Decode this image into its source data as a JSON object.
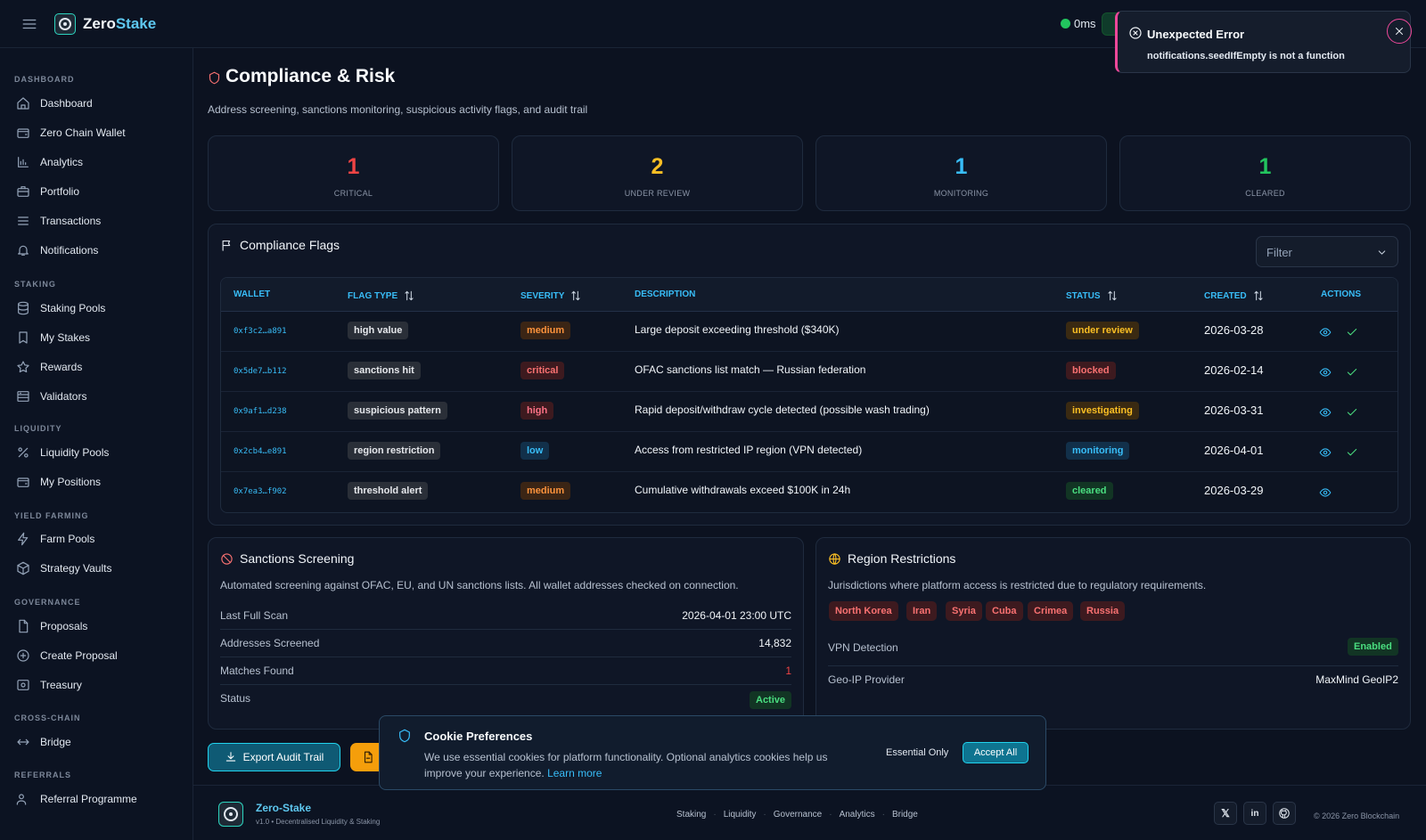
{
  "brand": {
    "name_a": "Zero",
    "name_b": "Stake"
  },
  "header": {
    "latency": "0ms"
  },
  "sidebar": {
    "sections": {
      "dashboard": "DASHBOARD",
      "staking": "STAKING",
      "liquidity": "LIQUIDITY",
      "yield": "YIELD FARMING",
      "governance": "GOVERNANCE",
      "crosschain": "CROSS-CHAIN",
      "referrals": "REFERRALS"
    },
    "items": {
      "dashboard": "Dashboard",
      "wallet": "Zero Chain Wallet",
      "analytics": "Analytics",
      "portfolio": "Portfolio",
      "transactions": "Transactions",
      "notifications": "Notifications",
      "staking_pools": "Staking Pools",
      "my_stakes": "My Stakes",
      "rewards": "Rewards",
      "validators": "Validators",
      "liquidity_pools": "Liquidity Pools",
      "my_positions": "My Positions",
      "farm_pools": "Farm Pools",
      "strategy_vaults": "Strategy Vaults",
      "proposals": "Proposals",
      "create_proposal": "Create Proposal",
      "treasury": "Treasury",
      "bridge": "Bridge",
      "referral": "Referral Programme"
    }
  },
  "page": {
    "title": "Compliance & Risk",
    "subtitle": "Address screening, sanctions monitoring, suspicious activity flags, and audit trail"
  },
  "stats": [
    {
      "value": "1",
      "label": "CRITICAL",
      "color": "#ef4444"
    },
    {
      "value": "2",
      "label": "UNDER REVIEW",
      "color": "#fbbf24"
    },
    {
      "value": "1",
      "label": "MONITORING",
      "color": "#38bdf8"
    },
    {
      "value": "1",
      "label": "CLEARED",
      "color": "#22c55e"
    }
  ],
  "flags": {
    "title": "Compliance Flags",
    "filter_placeholder": "Filter",
    "columns": {
      "wallet": "WALLET",
      "flag_type": "FLAG TYPE",
      "severity": "SEVERITY",
      "description": "DESCRIPTION",
      "status": "STATUS",
      "created": "CREATED",
      "actions": "ACTIONS"
    },
    "rows": [
      {
        "wallet": "0xf3c2…a891",
        "flag_type": "high value",
        "severity": "medium",
        "description": "Large deposit exceeding threshold ($340K)",
        "status": "under review",
        "created": "2026-03-28"
      },
      {
        "wallet": "0x5de7…b112",
        "flag_type": "sanctions hit",
        "severity": "critical",
        "description": "OFAC sanctions list match — Russian federation",
        "status": "blocked",
        "created": "2026-02-14"
      },
      {
        "wallet": "0x9af1…d238",
        "flag_type": "suspicious pattern",
        "severity": "high",
        "description": "Rapid deposit/withdraw cycle detected (possible wash trading)",
        "status": "investigating",
        "created": "2026-03-31"
      },
      {
        "wallet": "0x2cb4…e891",
        "flag_type": "region restriction",
        "severity": "low",
        "description": "Access from restricted IP region (VPN detected)",
        "status": "monitoring",
        "created": "2026-04-01"
      },
      {
        "wallet": "0x7ea3…f902",
        "flag_type": "threshold alert",
        "severity": "medium",
        "description": "Cumulative withdrawals exceed $100K in 24h",
        "status": "cleared",
        "created": "2026-03-29"
      }
    ]
  },
  "sanctions": {
    "title": "Sanctions Screening",
    "description": "Automated screening against OFAC, EU, and UN sanctions lists. All wallet addresses checked on connection.",
    "last_scan_label": "Last Full Scan",
    "last_scan_value": "2026-04-01 23:00 UTC",
    "screened_label": "Addresses Screened",
    "screened_value": "14,832",
    "matches_label": "Matches Found",
    "matches_value": "1",
    "status_label": "Status",
    "status_value": "Active"
  },
  "regions": {
    "title": "Region Restrictions",
    "description": "Jurisdictions where platform access is restricted due to regulatory requirements.",
    "countries": [
      "North Korea",
      "Iran",
      "Syria",
      "Cuba",
      "Crimea",
      "Russia"
    ],
    "vpn_label": "VPN Detection",
    "vpn_value": "Enabled",
    "geoip_label": "Geo-IP Provider",
    "geoip_value": "MaxMind GeoIP2"
  },
  "actions": {
    "export": "Export Audit Trail"
  },
  "cookie": {
    "title": "Cookie Preferences",
    "text": "We use essential cookies for platform functionality. Optional analytics cookies help us improve your experience.",
    "learn_more": "Learn more",
    "essential": "Essential Only",
    "accept": "Accept All"
  },
  "footer": {
    "name": "Zero-Stake",
    "version": "v1.0 • Decentralised Liquidity & Staking",
    "links": [
      "Staking",
      "Liquidity",
      "Governance",
      "Analytics",
      "Bridge"
    ],
    "copyright": "© 2026 Zero Blockchain"
  },
  "toast": {
    "title": "Unexpected Error",
    "message": "notifications.seedIfEmpty is not a function"
  }
}
